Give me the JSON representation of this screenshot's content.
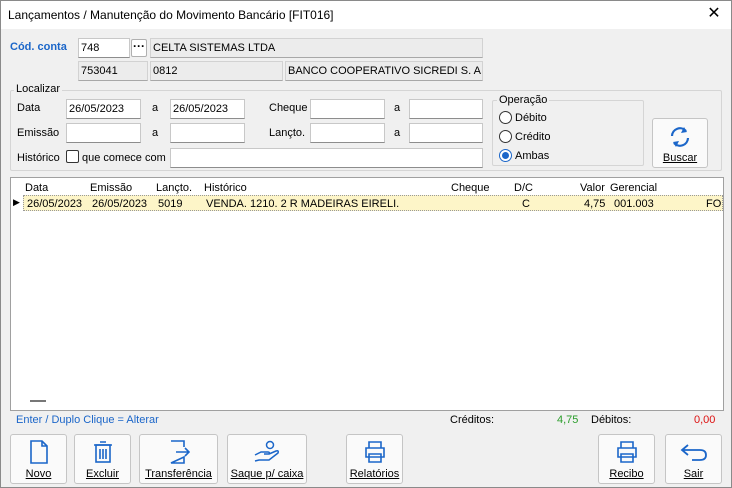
{
  "window": {
    "title": "Lançamentos / Manutenção do Movimento Bancário [FIT016]"
  },
  "account": {
    "label": "Cód. conta",
    "code": "748",
    "company": "CELTA SISTEMAS LTDA",
    "number": "753041",
    "agency": "0812",
    "bank": "BANCO COOPERATIVO SICREDI S. A."
  },
  "filter": {
    "legend": "Localizar",
    "date_label": "Data",
    "date_from": "26/05/2023",
    "to_label": "a",
    "date_to": "26/05/2023",
    "emission_label": "Emissão",
    "emission_from": "",
    "emission_to": "",
    "history_label": "Histórico",
    "starts_with_label": "que comece com",
    "history_value": "",
    "cheque_label": "Cheque",
    "cheque_from": "",
    "cheque_to": "",
    "lancto_label": "Lançto.",
    "lancto_from": "",
    "lancto_to": ""
  },
  "operation": {
    "legend": "Operação",
    "options": [
      "Débito",
      "Crédito",
      "Ambas"
    ],
    "selected": "Ambas"
  },
  "search_button": {
    "label": "Buscar"
  },
  "table": {
    "columns": [
      "Data",
      "Emissão",
      "Lançto.",
      "Histórico",
      "Cheque",
      "D/C",
      "Valor",
      "Gerencial"
    ],
    "rows": [
      {
        "data": "26/05/2023",
        "emissao": "26/05/2023",
        "lancto": "5019",
        "historico": "VENDA. 1210. 2 R MADEIRAS EIRELI.",
        "cheque": "",
        "dc": "C",
        "valor": "4,75",
        "gerencial": "001.003",
        "extra": "FO"
      }
    ]
  },
  "status": {
    "hint": "Enter / Duplo Clique = Alterar",
    "credits_label": "Créditos:",
    "credits_value": "4,75",
    "debits_label": "Débitos:",
    "debits_value": "0,00"
  },
  "toolbar": {
    "novo": "Novo",
    "excluir": "Excluir",
    "transferencia": "Transferência",
    "saque": "Saque p/ caixa",
    "relatorios": "Relatórios",
    "recibo": "Recibo",
    "sair": "Sair"
  },
  "colors": {
    "accent": "#1b66c9",
    "row_highlight": "#fdf5c8",
    "credit": "#2a9d2a",
    "debit": "#dd1111"
  }
}
